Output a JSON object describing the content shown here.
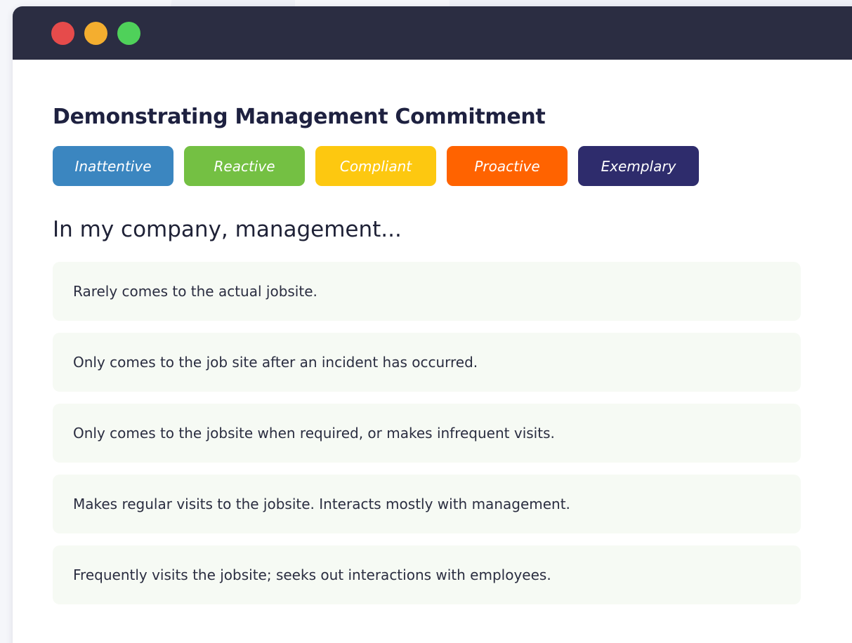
{
  "window": {
    "controls": [
      {
        "name": "close",
        "color": "#e64b4b"
      },
      {
        "name": "minimize",
        "color": "#f4ae2f"
      },
      {
        "name": "maximize",
        "color": "#4fd15a"
      }
    ],
    "titlebar_color": "#2b2d42"
  },
  "page": {
    "title": "Demonstrating Management Commitment",
    "prompt": "In my company, management..."
  },
  "levels": [
    {
      "label": "Inattentive",
      "color": "#3b86c0"
    },
    {
      "label": "Reactive",
      "color": "#74c043"
    },
    {
      "label": "Compliant",
      "color": "#fdc810"
    },
    {
      "label": "Proactive",
      "color": "#ff6300"
    },
    {
      "label": "Exemplary",
      "color": "#2e2c6c"
    }
  ],
  "options": [
    {
      "text": "Rarely comes to the actual jobsite."
    },
    {
      "text": "Only comes to the job site after an incident has occurred."
    },
    {
      "text": "Only comes to the jobsite when required, or makes infrequent visits."
    },
    {
      "text": "Makes regular visits to the jobsite. Interacts mostly with management."
    },
    {
      "text": "Frequently visits the jobsite; seeks out interactions with employees."
    }
  ]
}
